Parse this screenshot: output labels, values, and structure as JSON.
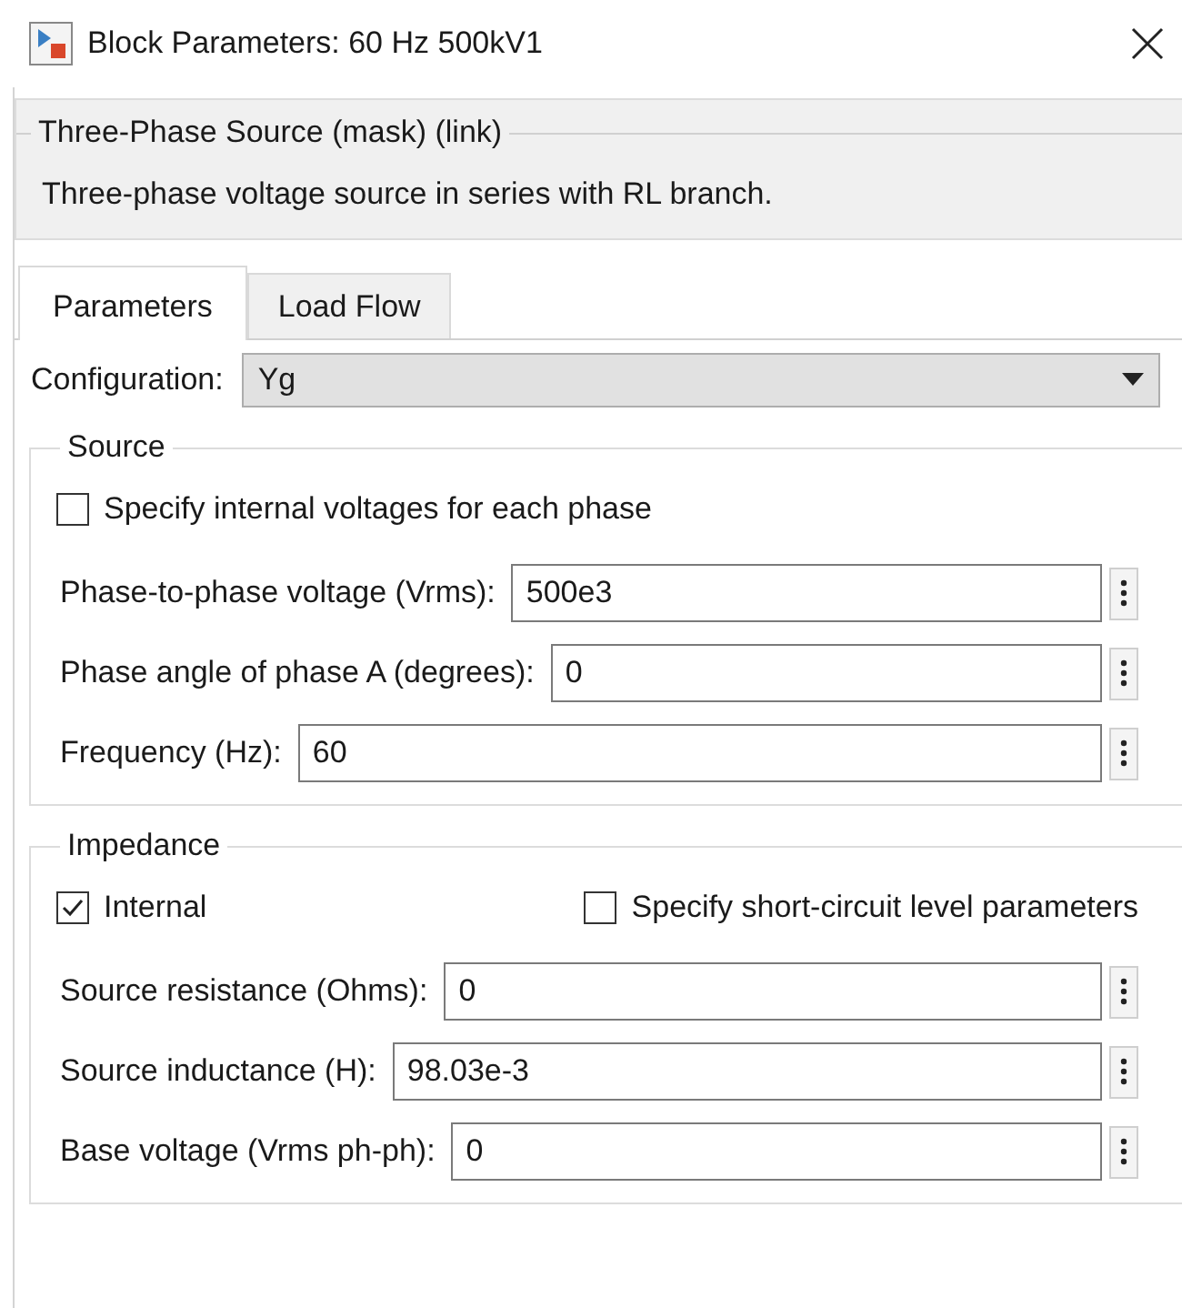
{
  "window": {
    "title": "Block Parameters: 60 Hz 500kV1"
  },
  "mask": {
    "title": "Three-Phase Source (mask) (link)",
    "description": "Three-phase voltage source in series with RL branch."
  },
  "tabs": [
    {
      "label": "Parameters",
      "selected": true
    },
    {
      "label": "Load Flow",
      "selected": false
    }
  ],
  "configuration": {
    "label": "Configuration:",
    "value": "Yg"
  },
  "groups": [
    {
      "title": "Source",
      "checkboxes": [
        {
          "label": "Specify internal voltages for each phase",
          "checked": false
        }
      ],
      "fields": [
        {
          "label": "Phase-to-phase voltage (Vrms):",
          "value": "500e3"
        },
        {
          "label": "Phase angle of phase A (degrees):",
          "value": "0"
        },
        {
          "label": "Frequency (Hz):",
          "value": "60"
        }
      ]
    },
    {
      "title": "Impedance",
      "checkboxes": [
        {
          "label": "Internal",
          "checked": true
        },
        {
          "label": "Specify short-circuit level parameters",
          "checked": false
        }
      ],
      "fields": [
        {
          "label": "Source resistance (Ohms):",
          "value": "0"
        },
        {
          "label": "Source inductance (H):",
          "value": "98.03e-3"
        },
        {
          "label": "Base voltage (Vrms ph-ph):",
          "value": "0"
        }
      ]
    }
  ]
}
